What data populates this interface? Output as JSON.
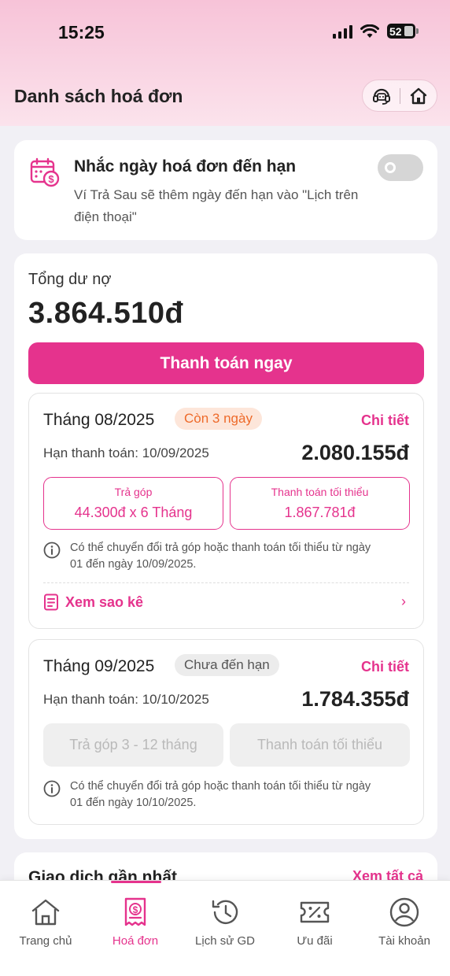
{
  "status_bar": {
    "time": "15:25",
    "battery": "52"
  },
  "header": {
    "title": "Danh sách hoá đơn"
  },
  "reminder": {
    "title": "Nhắc ngày hoá đơn đến hạn",
    "description": "Ví Trả Sau sẽ thêm ngày đến hạn vào \"Lịch trên điện thoại\"",
    "enabled": false
  },
  "summary": {
    "label": "Tổng dư nợ",
    "amount": "3.864.510đ",
    "pay_button": "Thanh toán ngay"
  },
  "bills": [
    {
      "month": "Tháng 08/2025",
      "badge": "Còn 3 ngày",
      "detail_link": "Chi tiết",
      "due": "Hạn thanh toán: 10/09/2025",
      "amount": "2.080.155đ",
      "installment_title": "Trả góp",
      "installment_value": "44.300đ x 6 Tháng",
      "minimum_title": "Thanh toán tối thiểu",
      "minimum_value": "1.867.781đ",
      "note": "Có thể chuyển đổi trả góp hoặc thanh toán tối thiểu từ ngày 01 đến ngày 10/09/2025.",
      "statement_link": "Xem sao kê"
    },
    {
      "month": "Tháng 09/2025",
      "badge": "Chưa đến hạn",
      "detail_link": "Chi tiết",
      "due": "Hạn thanh toán: 10/10/2025",
      "amount": "1.784.355đ",
      "installment_disabled": "Trả góp 3 - 12 tháng",
      "minimum_disabled": "Thanh toán tối thiểu",
      "note": "Có thể chuyển đổi trả góp hoặc thanh toán tối thiểu từ ngày 01 đến ngày 10/10/2025."
    }
  ],
  "recent": {
    "title": "Giao dịch gần nhất",
    "link": "Xem tất cả"
  },
  "nav": [
    {
      "label": "Trang chủ",
      "icon": "home-icon"
    },
    {
      "label": "Hoá đơn",
      "icon": "bill-icon",
      "active": true
    },
    {
      "label": "Lịch sử GD",
      "icon": "history-icon"
    },
    {
      "label": "Ưu đãi",
      "icon": "voucher-icon"
    },
    {
      "label": "Tài khoản",
      "icon": "account-icon"
    }
  ],
  "colors": {
    "accent": "#e5338d",
    "warning": "#ee6a2a",
    "background": "#f1f0f5"
  }
}
